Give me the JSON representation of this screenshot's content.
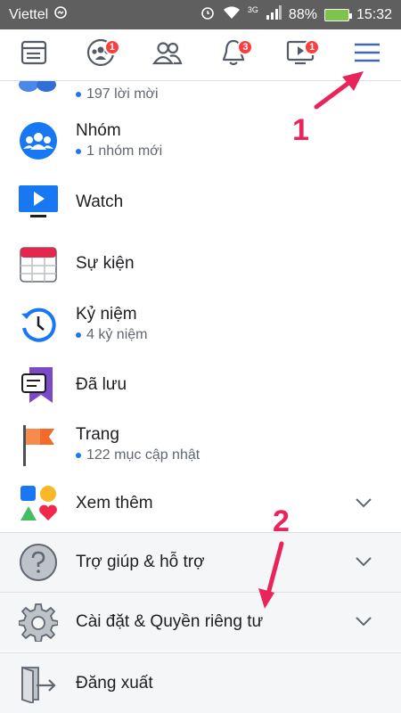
{
  "status_bar": {
    "carrier": "Viettel",
    "network": "3G",
    "battery": "88%",
    "time": "15:32"
  },
  "navbar": {
    "items": [
      {
        "icon": "news-feed-icon",
        "badge": ""
      },
      {
        "icon": "groups-icon",
        "badge": "1"
      },
      {
        "icon": "friends-icon",
        "badge": ""
      },
      {
        "icon": "notifications-icon",
        "badge": "3"
      },
      {
        "icon": "watch-icon",
        "badge": "1"
      },
      {
        "icon": "menu-icon",
        "badge": ""
      }
    ],
    "active_color": "#4267b2"
  },
  "menu": {
    "friends_sub": "197 lời mời",
    "items": [
      {
        "label": "Nhóm",
        "sub": "1 nhóm mới"
      },
      {
        "label": "Watch",
        "sub": ""
      },
      {
        "label": "Sự kiện",
        "sub": ""
      },
      {
        "label": "Kỷ niệm",
        "sub": "4 kỷ niệm"
      },
      {
        "label": "Đã lưu",
        "sub": ""
      },
      {
        "label": "Trang",
        "sub": "122 mục cập nhật"
      },
      {
        "label": "Xem thêm",
        "sub": ""
      }
    ],
    "sections": [
      {
        "label": "Trợ giúp & hỗ trợ"
      },
      {
        "label": "Cài đặt & Quyền riêng tư"
      }
    ],
    "logout": "Đăng xuất"
  },
  "annotations": {
    "step1": "1",
    "step2": "2",
    "color": "#e8245b"
  }
}
